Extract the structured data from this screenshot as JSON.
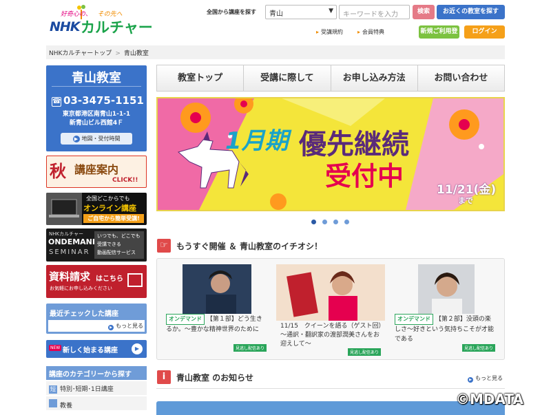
{
  "header": {
    "tagline_a": "好奇心の、",
    "tagline_b": "その先へ",
    "logo_nhk": "NHK",
    "logo_culture": "カルチャー",
    "search_label": "全国から講座を探す",
    "area_select_value": "青山",
    "keyword_placeholder": "キーワードを入力",
    "search_button": "検索",
    "nearby_button": "お近くの教室を探す",
    "link_terms": "受講規約",
    "link_benefits": "会員特典",
    "register_button": "新規ご利用登録",
    "login_button": "ログイン"
  },
  "breadcrumb": {
    "home": "NHKカルチャートップ",
    "current": "青山教室"
  },
  "classroom": {
    "name": "青山教室",
    "phone": "03-3475-1151",
    "address_line1": "東京都港区南青山1-1-1",
    "address_line2": "新青山ビル西館4Ｆ",
    "map_button": "地図・受付時間"
  },
  "banners": {
    "aki_char": "秋",
    "aki_text": "講座案内",
    "aki_click": "CLICK!!",
    "online_top": "全国どこからでも",
    "online_main": "オンライン講座",
    "online_sub": "ご自宅から簡単受講!",
    "od_nhk": "NHKカルチャー",
    "od_big": "ONDEMAND",
    "od_seminar": "SEMINAR",
    "od_t1": "いつでも、どこでも",
    "od_t2": "受講できる",
    "od_t3": "動画配信サービス",
    "shiryo_main": "資料請求",
    "shiryo_kochira": "はこちら",
    "shiryo_sub": "お気軽にお申し込みください",
    "recent_title": "最近チェックした講座",
    "recent_more": "もっと見る",
    "new_badge": "NEW",
    "new_courses": "新しく始まる講座"
  },
  "categories": {
    "title": "講座のカテゴリーから探す",
    "items": [
      {
        "key": "短",
        "label": "特別･短期･1日講座"
      },
      {
        "key": "",
        "label": "教養"
      }
    ]
  },
  "nav_tabs": [
    "教室トップ",
    "受講に際して",
    "お申し込み方法",
    "お問い合わせ"
  ],
  "hero": {
    "term": "1月期",
    "title_line1": "優先継続",
    "title_line2": "受付中",
    "date_day": "11/21",
    "date_weekday": "金",
    "date_until": "まで"
  },
  "pickup": {
    "title": "もうすぐ開催 ＆ 青山教室のイチオシ！",
    "cards": [
      {
        "tag": "オンデマンド",
        "text": "【第１部】どう生きるか。～豊かな精神世界のために",
        "mi": "見逃し配信あり"
      },
      {
        "tag": "",
        "text": "11/15　クイーンを語る（ゲスト回）　～通訳・翻訳家の渡部潤美さんをお迎えして～",
        "mi": "見逃し配信あり"
      },
      {
        "tag": "オンデマンド",
        "text": "【第２部】没頭の楽しさ～好きという気持ちこそが才能である",
        "mi": "見逃し配信あり"
      }
    ]
  },
  "notice": {
    "title": "青山教室 のお知らせ",
    "more": "もっと見る"
  },
  "watermark": "©MDATA",
  "colors": {
    "brand_blue": "#3b73c9",
    "accent_orange": "#f5a019",
    "green": "#7cc240",
    "red": "#c0202d"
  }
}
